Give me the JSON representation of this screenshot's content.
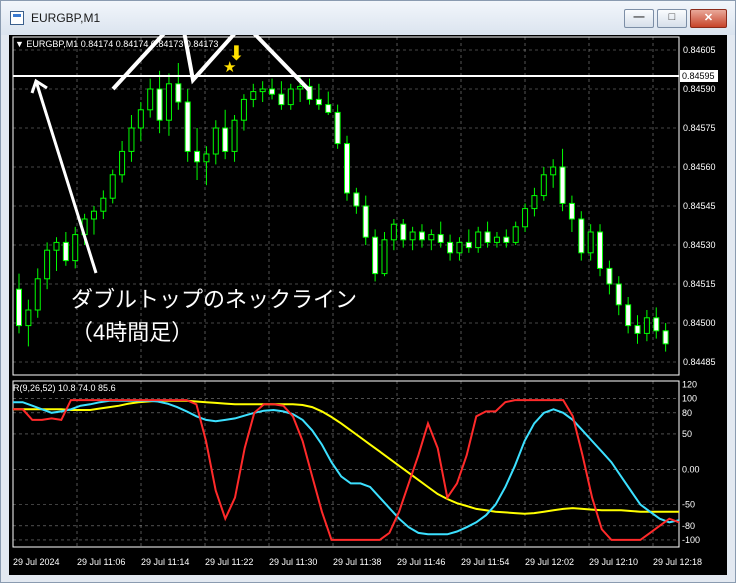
{
  "window": {
    "title": "EURGBP,M1",
    "minimize_label": "—",
    "maximize_label": "□",
    "close_label": "✕"
  },
  "main_chart": {
    "info": "▼ EURGBP,M1  0.84174 0.84174 0.84173 0.84173",
    "price_ticks": [
      "0.84605",
      "0.84590",
      "0.84575",
      "0.84560",
      "0.84545",
      "0.84530",
      "0.84515",
      "0.84500",
      "0.84485"
    ],
    "neckline_price_label": "0.84595",
    "annotation_line1": "ダブルトップのネックライン",
    "annotation_line2": "（4時間足）",
    "star_glyph": "★",
    "arrow_glyph": "⬇"
  },
  "indicator": {
    "info": "R(9,26,52) 10.8 74.0 85.6",
    "ticks": [
      "120",
      "100",
      "80",
      "50",
      "0.00",
      "-50",
      "-80",
      "-100"
    ]
  },
  "time_axis": [
    "29 Jul 2024",
    "29 Jul 11:06",
    "29 Jul 11:14",
    "29 Jul 11:22",
    "29 Jul 11:30",
    "29 Jul 11:38",
    "29 Jul 11:46",
    "29 Jul 11:54",
    "29 Jul 12:02",
    "29 Jul 12:10",
    "29 Jul 12:18"
  ],
  "colors": {
    "background": "#000000",
    "grid": "#ffffff",
    "candle": "#00ff00",
    "neckline": "#ffffff",
    "red": "#ff2a2a",
    "cyan": "#3ce0ff",
    "yellow": "#ffff00",
    "star": "#ffe000"
  },
  "candles": [
    [
      0.84513,
      0.84519,
      0.84496,
      0.84499
    ],
    [
      0.84499,
      0.84509,
      0.84491,
      0.84505
    ],
    [
      0.84505,
      0.84521,
      0.84502,
      0.84517
    ],
    [
      0.84517,
      0.84531,
      0.84513,
      0.84528
    ],
    [
      0.84528,
      0.84533,
      0.8452,
      0.84531
    ],
    [
      0.84531,
      0.84535,
      0.84522,
      0.84524
    ],
    [
      0.84524,
      0.84537,
      0.84521,
      0.84534
    ],
    [
      0.84534,
      0.84542,
      0.8453,
      0.8454
    ],
    [
      0.8454,
      0.84545,
      0.84534,
      0.84543
    ],
    [
      0.84543,
      0.84551,
      0.8454,
      0.84548
    ],
    [
      0.84548,
      0.84559,
      0.84546,
      0.84557
    ],
    [
      0.84557,
      0.8457,
      0.84554,
      0.84566
    ],
    [
      0.84566,
      0.8458,
      0.84562,
      0.84575
    ],
    [
      0.84575,
      0.84585,
      0.8457,
      0.84582
    ],
    [
      0.84582,
      0.84594,
      0.84579,
      0.8459
    ],
    [
      0.8459,
      0.84597,
      0.84573,
      0.84578
    ],
    [
      0.84578,
      0.84596,
      0.84572,
      0.84592
    ],
    [
      0.84592,
      0.846,
      0.84582,
      0.84585
    ],
    [
      0.84585,
      0.8459,
      0.84562,
      0.84566
    ],
    [
      0.84566,
      0.84575,
      0.84555,
      0.84562
    ],
    [
      0.84562,
      0.84568,
      0.84553,
      0.84565
    ],
    [
      0.84565,
      0.84578,
      0.84561,
      0.84575
    ],
    [
      0.84575,
      0.84582,
      0.84563,
      0.84566
    ],
    [
      0.84566,
      0.8458,
      0.84562,
      0.84578
    ],
    [
      0.84578,
      0.84588,
      0.84574,
      0.84586
    ],
    [
      0.84586,
      0.84592,
      0.84583,
      0.84589
    ],
    [
      0.84589,
      0.84593,
      0.84585,
      0.8459
    ],
    [
      0.8459,
      0.84594,
      0.84586,
      0.84588
    ],
    [
      0.84588,
      0.84593,
      0.84582,
      0.84584
    ],
    [
      0.84584,
      0.84592,
      0.84582,
      0.8459
    ],
    [
      0.8459,
      0.84595,
      0.84585,
      0.84591
    ],
    [
      0.84591,
      0.84594,
      0.84584,
      0.84586
    ],
    [
      0.84586,
      0.84592,
      0.84582,
      0.84584
    ],
    [
      0.84584,
      0.84589,
      0.8458,
      0.84581
    ],
    [
      0.84581,
      0.84584,
      0.84567,
      0.84569
    ],
    [
      0.84569,
      0.84572,
      0.84547,
      0.8455
    ],
    [
      0.8455,
      0.84552,
      0.84542,
      0.84545
    ],
    [
      0.84545,
      0.84549,
      0.8453,
      0.84533
    ],
    [
      0.84533,
      0.84536,
      0.84516,
      0.84519
    ],
    [
      0.84519,
      0.84535,
      0.84518,
      0.84532
    ],
    [
      0.84532,
      0.8454,
      0.84528,
      0.84538
    ],
    [
      0.84538,
      0.8454,
      0.84529,
      0.84532
    ],
    [
      0.84532,
      0.84537,
      0.84528,
      0.84535
    ],
    [
      0.84535,
      0.84538,
      0.84529,
      0.84532
    ],
    [
      0.84532,
      0.84536,
      0.84528,
      0.84534
    ],
    [
      0.84534,
      0.84539,
      0.84529,
      0.84531
    ],
    [
      0.84531,
      0.84534,
      0.84524,
      0.84527
    ],
    [
      0.84527,
      0.84533,
      0.84524,
      0.84531
    ],
    [
      0.84531,
      0.84536,
      0.84527,
      0.84529
    ],
    [
      0.84529,
      0.84537,
      0.84527,
      0.84535
    ],
    [
      0.84535,
      0.84539,
      0.84529,
      0.84531
    ],
    [
      0.84531,
      0.84535,
      0.84529,
      0.84533
    ],
    [
      0.84533,
      0.84536,
      0.84529,
      0.84531
    ],
    [
      0.84531,
      0.84539,
      0.8453,
      0.84537
    ],
    [
      0.84537,
      0.84546,
      0.84535,
      0.84544
    ],
    [
      0.84544,
      0.84552,
      0.84541,
      0.84549
    ],
    [
      0.84549,
      0.8456,
      0.84547,
      0.84557
    ],
    [
      0.84557,
      0.84563,
      0.84552,
      0.8456
    ],
    [
      0.8456,
      0.84567,
      0.84543,
      0.84546
    ],
    [
      0.84546,
      0.84549,
      0.84535,
      0.8454
    ],
    [
      0.8454,
      0.84543,
      0.84524,
      0.84527
    ],
    [
      0.84527,
      0.84538,
      0.84524,
      0.84535
    ],
    [
      0.84535,
      0.84538,
      0.84518,
      0.84521
    ],
    [
      0.84521,
      0.84524,
      0.84511,
      0.84515
    ],
    [
      0.84515,
      0.84518,
      0.84503,
      0.84507
    ],
    [
      0.84507,
      0.8451,
      0.84496,
      0.84499
    ],
    [
      0.84499,
      0.84503,
      0.84492,
      0.84496
    ],
    [
      0.84496,
      0.84505,
      0.84493,
      0.84502
    ],
    [
      0.84502,
      0.84506,
      0.84494,
      0.84497
    ],
    [
      0.84497,
      0.845,
      0.84489,
      0.84492
    ]
  ],
  "neckline_price": 0.84595,
  "indicator_series": {
    "red": [
      85,
      85,
      70,
      70,
      72,
      70,
      98,
      98,
      98,
      98,
      98,
      98,
      98,
      98,
      98,
      98,
      98,
      98,
      98,
      92,
      40,
      -30,
      -70,
      -40,
      30,
      80,
      92,
      92,
      90,
      75,
      40,
      -10,
      -60,
      -100,
      -100,
      -100,
      -100,
      -100,
      -100,
      -90,
      -60,
      -20,
      20,
      65,
      30,
      -40,
      -20,
      20,
      75,
      82,
      82,
      95,
      98,
      98,
      98,
      98,
      98,
      98,
      75,
      20,
      -40,
      -85,
      -100,
      -100,
      -100,
      -100,
      -90,
      -80,
      -70,
      -75
    ],
    "cyan": [
      95,
      95,
      90,
      85,
      80,
      82,
      85,
      90,
      92,
      95,
      97,
      97,
      97,
      97,
      97,
      96,
      93,
      88,
      82,
      75,
      70,
      68,
      70,
      72,
      76,
      80,
      83,
      84,
      82,
      78,
      70,
      55,
      35,
      10,
      -10,
      -20,
      -20,
      -25,
      -40,
      -55,
      -70,
      -82,
      -90,
      -92,
      -92,
      -92,
      -88,
      -82,
      -75,
      -65,
      -50,
      -25,
      5,
      40,
      65,
      80,
      85,
      80,
      70,
      55,
      40,
      25,
      10,
      -10,
      -30,
      -50,
      -60,
      -70,
      -75,
      -72
    ],
    "yellow": [
      85,
      85,
      85,
      85,
      85,
      85,
      84,
      84,
      84,
      86,
      88,
      90,
      93,
      95,
      96,
      97,
      97,
      97,
      97,
      96,
      95,
      94,
      93,
      92,
      92,
      92,
      92,
      92,
      92,
      92,
      91,
      88,
      82,
      74,
      65,
      55,
      45,
      35,
      25,
      15,
      5,
      -5,
      -15,
      -25,
      -35,
      -42,
      -48,
      -52,
      -56,
      -58,
      -60,
      -61,
      -62,
      -63,
      -62,
      -60,
      -58,
      -56,
      -55,
      -56,
      -57,
      -58,
      -58,
      -58,
      -59,
      -60,
      -60,
      -60,
      -60,
      -60
    ]
  }
}
